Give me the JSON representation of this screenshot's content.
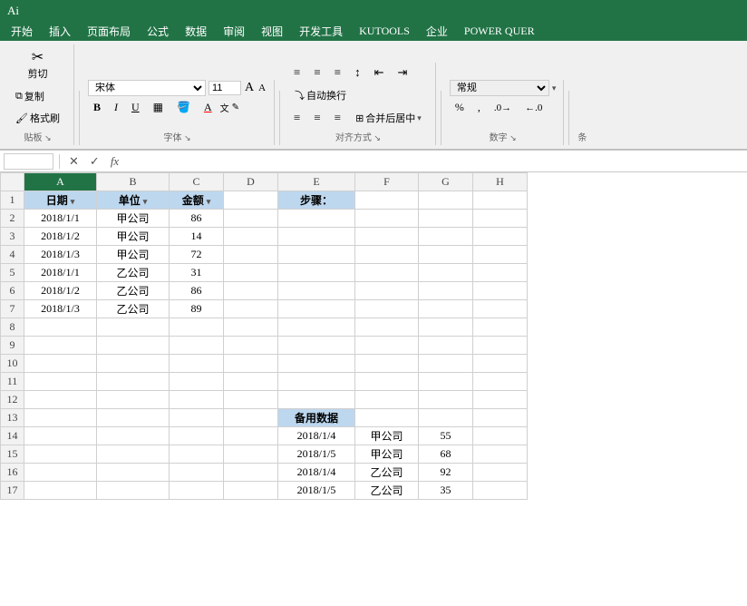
{
  "titleBar": {
    "appName": "Ai",
    "bgColor": "#217346"
  },
  "menuBar": {
    "items": [
      "开始",
      "插入",
      "页面布局",
      "公式",
      "数据",
      "审阅",
      "视图",
      "开发工具",
      "KUTOOLS",
      "企业",
      "POWER QUER"
    ]
  },
  "ribbon": {
    "groups": [
      {
        "name": "贴板",
        "buttons": [
          {
            "label": "剪切",
            "icon": "✂"
          },
          {
            "label": "复制",
            "icon": "⧉"
          },
          {
            "label": "格式刷",
            "icon": "🖌"
          }
        ]
      },
      {
        "name": "字体",
        "fontName": "宋体",
        "fontSize": "11",
        "boldLabel": "B",
        "italicLabel": "I",
        "underlineLabel": "U"
      },
      {
        "name": "对齐方式",
        "wrapText": "自动换行",
        "merge": "合并后居中"
      },
      {
        "name": "数字",
        "format": "常规"
      }
    ]
  },
  "formulaBar": {
    "nameBox": "",
    "formula": ""
  },
  "spreadsheet": {
    "colHeaders": [
      "",
      "A",
      "B",
      "C",
      "D",
      "E",
      "F",
      "G",
      "H"
    ],
    "rows": [
      {
        "id": 1,
        "cells": [
          {
            "col": "A",
            "value": "日期",
            "type": "header",
            "hasDropdown": true
          },
          {
            "col": "B",
            "value": "单位",
            "type": "header",
            "hasDropdown": true
          },
          {
            "col": "C",
            "value": "金额",
            "type": "header",
            "hasDropdown": true
          },
          {
            "col": "D",
            "value": "",
            "type": "normal"
          },
          {
            "col": "E",
            "value": "步骤：",
            "type": "step-header"
          },
          {
            "col": "F",
            "value": "",
            "type": "normal"
          },
          {
            "col": "G",
            "value": "",
            "type": "normal"
          },
          {
            "col": "H",
            "value": "",
            "type": "normal"
          }
        ]
      },
      {
        "id": 2,
        "cells": [
          {
            "col": "A",
            "value": "2018/1/1",
            "type": "normal"
          },
          {
            "col": "B",
            "value": "甲公司",
            "type": "normal"
          },
          {
            "col": "C",
            "value": "86",
            "type": "number"
          },
          {
            "col": "D",
            "value": "",
            "type": "normal"
          },
          {
            "col": "E",
            "value": "",
            "type": "normal"
          },
          {
            "col": "F",
            "value": "",
            "type": "normal"
          },
          {
            "col": "G",
            "value": "",
            "type": "normal"
          },
          {
            "col": "H",
            "value": "",
            "type": "normal"
          }
        ]
      },
      {
        "id": 3,
        "cells": [
          {
            "col": "A",
            "value": "2018/1/2",
            "type": "normal"
          },
          {
            "col": "B",
            "value": "甲公司",
            "type": "normal"
          },
          {
            "col": "C",
            "value": "14",
            "type": "number"
          },
          {
            "col": "D",
            "value": "",
            "type": "normal"
          },
          {
            "col": "E",
            "value": "",
            "type": "normal"
          },
          {
            "col": "F",
            "value": "",
            "type": "normal"
          },
          {
            "col": "G",
            "value": "",
            "type": "normal"
          },
          {
            "col": "H",
            "value": "",
            "type": "normal"
          }
        ]
      },
      {
        "id": 4,
        "cells": [
          {
            "col": "A",
            "value": "2018/1/3",
            "type": "normal"
          },
          {
            "col": "B",
            "value": "甲公司",
            "type": "normal"
          },
          {
            "col": "C",
            "value": "72",
            "type": "number"
          },
          {
            "col": "D",
            "value": "",
            "type": "normal"
          },
          {
            "col": "E",
            "value": "",
            "type": "normal"
          },
          {
            "col": "F",
            "value": "",
            "type": "normal"
          },
          {
            "col": "G",
            "value": "",
            "type": "normal"
          },
          {
            "col": "H",
            "value": "",
            "type": "normal"
          }
        ]
      },
      {
        "id": 5,
        "cells": [
          {
            "col": "A",
            "value": "2018/1/1",
            "type": "normal"
          },
          {
            "col": "B",
            "value": "乙公司",
            "type": "normal"
          },
          {
            "col": "C",
            "value": "31",
            "type": "number"
          },
          {
            "col": "D",
            "value": "",
            "type": "normal"
          },
          {
            "col": "E",
            "value": "",
            "type": "normal"
          },
          {
            "col": "F",
            "value": "",
            "type": "normal"
          },
          {
            "col": "G",
            "value": "",
            "type": "normal"
          },
          {
            "col": "H",
            "value": "",
            "type": "normal"
          }
        ]
      },
      {
        "id": 6,
        "cells": [
          {
            "col": "A",
            "value": "2018/1/2",
            "type": "normal"
          },
          {
            "col": "B",
            "value": "乙公司",
            "type": "normal"
          },
          {
            "col": "C",
            "value": "86",
            "type": "number"
          },
          {
            "col": "D",
            "value": "",
            "type": "normal"
          },
          {
            "col": "E",
            "value": "",
            "type": "normal"
          },
          {
            "col": "F",
            "value": "",
            "type": "normal"
          },
          {
            "col": "G",
            "value": "",
            "type": "normal"
          },
          {
            "col": "H",
            "value": "",
            "type": "normal"
          }
        ]
      },
      {
        "id": 7,
        "cells": [
          {
            "col": "A",
            "value": "2018/1/3",
            "type": "normal"
          },
          {
            "col": "B",
            "value": "乙公司",
            "type": "normal"
          },
          {
            "col": "C",
            "value": "89",
            "type": "number"
          },
          {
            "col": "D",
            "value": "",
            "type": "normal"
          },
          {
            "col": "E",
            "value": "",
            "type": "normal"
          },
          {
            "col": "F",
            "value": "",
            "type": "normal"
          },
          {
            "col": "G",
            "value": "",
            "type": "normal"
          },
          {
            "col": "H",
            "value": "",
            "type": "normal"
          }
        ]
      },
      {
        "id": 8,
        "cells": [
          {
            "col": "A",
            "value": "",
            "type": "normal"
          },
          {
            "col": "B",
            "value": "",
            "type": "normal"
          },
          {
            "col": "C",
            "value": "",
            "type": "normal"
          },
          {
            "col": "D",
            "value": "",
            "type": "normal"
          },
          {
            "col": "E",
            "value": "",
            "type": "normal"
          },
          {
            "col": "F",
            "value": "",
            "type": "normal"
          },
          {
            "col": "G",
            "value": "",
            "type": "normal"
          },
          {
            "col": "H",
            "value": "",
            "type": "normal"
          }
        ]
      },
      {
        "id": 9,
        "cells": [
          {
            "col": "A",
            "value": "",
            "type": "normal"
          },
          {
            "col": "B",
            "value": "",
            "type": "normal"
          },
          {
            "col": "C",
            "value": "",
            "type": "normal"
          },
          {
            "col": "D",
            "value": "",
            "type": "normal"
          },
          {
            "col": "E",
            "value": "",
            "type": "normal"
          },
          {
            "col": "F",
            "value": "",
            "type": "normal"
          },
          {
            "col": "G",
            "value": "",
            "type": "normal"
          },
          {
            "col": "H",
            "value": "",
            "type": "normal"
          }
        ]
      },
      {
        "id": 10,
        "cells": [
          {
            "col": "A",
            "value": "",
            "type": "normal"
          },
          {
            "col": "B",
            "value": "",
            "type": "normal"
          },
          {
            "col": "C",
            "value": "",
            "type": "normal"
          },
          {
            "col": "D",
            "value": "",
            "type": "normal"
          },
          {
            "col": "E",
            "value": "",
            "type": "normal"
          },
          {
            "col": "F",
            "value": "",
            "type": "normal"
          },
          {
            "col": "G",
            "value": "",
            "type": "normal"
          },
          {
            "col": "H",
            "value": "",
            "type": "normal"
          }
        ]
      },
      {
        "id": 11,
        "cells": [
          {
            "col": "A",
            "value": "",
            "type": "normal"
          },
          {
            "col": "B",
            "value": "",
            "type": "normal"
          },
          {
            "col": "C",
            "value": "",
            "type": "normal"
          },
          {
            "col": "D",
            "value": "",
            "type": "normal"
          },
          {
            "col": "E",
            "value": "",
            "type": "normal"
          },
          {
            "col": "F",
            "value": "",
            "type": "normal"
          },
          {
            "col": "G",
            "value": "",
            "type": "normal"
          },
          {
            "col": "H",
            "value": "",
            "type": "normal"
          }
        ]
      },
      {
        "id": 12,
        "cells": [
          {
            "col": "A",
            "value": "",
            "type": "normal"
          },
          {
            "col": "B",
            "value": "",
            "type": "normal"
          },
          {
            "col": "C",
            "value": "",
            "type": "normal"
          },
          {
            "col": "D",
            "value": "",
            "type": "normal"
          },
          {
            "col": "E",
            "value": "",
            "type": "normal"
          },
          {
            "col": "F",
            "value": "",
            "type": "normal"
          },
          {
            "col": "G",
            "value": "",
            "type": "normal"
          },
          {
            "col": "H",
            "value": "",
            "type": "normal"
          }
        ]
      },
      {
        "id": 13,
        "cells": [
          {
            "col": "A",
            "value": "",
            "type": "normal"
          },
          {
            "col": "B",
            "value": "",
            "type": "normal"
          },
          {
            "col": "C",
            "value": "",
            "type": "normal"
          },
          {
            "col": "D",
            "value": "",
            "type": "normal"
          },
          {
            "col": "E",
            "value": "备用数据",
            "type": "backup-header"
          },
          {
            "col": "F",
            "value": "",
            "type": "normal"
          },
          {
            "col": "G",
            "value": "",
            "type": "normal"
          },
          {
            "col": "H",
            "value": "",
            "type": "normal"
          }
        ]
      },
      {
        "id": 14,
        "cells": [
          {
            "col": "A",
            "value": "",
            "type": "normal"
          },
          {
            "col": "B",
            "value": "",
            "type": "normal"
          },
          {
            "col": "C",
            "value": "",
            "type": "normal"
          },
          {
            "col": "D",
            "value": "",
            "type": "normal"
          },
          {
            "col": "E",
            "value": "2018/1/4",
            "type": "normal"
          },
          {
            "col": "F",
            "value": "甲公司",
            "type": "normal"
          },
          {
            "col": "G",
            "value": "55",
            "type": "number"
          },
          {
            "col": "H",
            "value": "",
            "type": "normal"
          }
        ]
      },
      {
        "id": 15,
        "cells": [
          {
            "col": "A",
            "value": "",
            "type": "normal"
          },
          {
            "col": "B",
            "value": "",
            "type": "normal"
          },
          {
            "col": "C",
            "value": "",
            "type": "normal"
          },
          {
            "col": "D",
            "value": "",
            "type": "normal"
          },
          {
            "col": "E",
            "value": "2018/1/5",
            "type": "normal"
          },
          {
            "col": "F",
            "value": "甲公司",
            "type": "normal"
          },
          {
            "col": "G",
            "value": "68",
            "type": "number"
          },
          {
            "col": "H",
            "value": "",
            "type": "normal"
          }
        ]
      },
      {
        "id": 16,
        "cells": [
          {
            "col": "A",
            "value": "",
            "type": "normal"
          },
          {
            "col": "B",
            "value": "",
            "type": "normal"
          },
          {
            "col": "C",
            "value": "",
            "type": "normal"
          },
          {
            "col": "D",
            "value": "",
            "type": "normal"
          },
          {
            "col": "E",
            "value": "2018/1/4",
            "type": "normal"
          },
          {
            "col": "F",
            "value": "乙公司",
            "type": "normal"
          },
          {
            "col": "G",
            "value": "92",
            "type": "number"
          },
          {
            "col": "H",
            "value": "",
            "type": "normal"
          }
        ]
      },
      {
        "id": 17,
        "cells": [
          {
            "col": "A",
            "value": "",
            "type": "normal"
          },
          {
            "col": "B",
            "value": "",
            "type": "normal"
          },
          {
            "col": "C",
            "value": "",
            "type": "normal"
          },
          {
            "col": "D",
            "value": "",
            "type": "normal"
          },
          {
            "col": "E",
            "value": "2018/1/5",
            "type": "normal"
          },
          {
            "col": "F",
            "value": "乙公司",
            "type": "normal"
          },
          {
            "col": "G",
            "value": "35",
            "type": "number"
          },
          {
            "col": "H",
            "value": "",
            "type": "normal"
          }
        ]
      }
    ]
  }
}
